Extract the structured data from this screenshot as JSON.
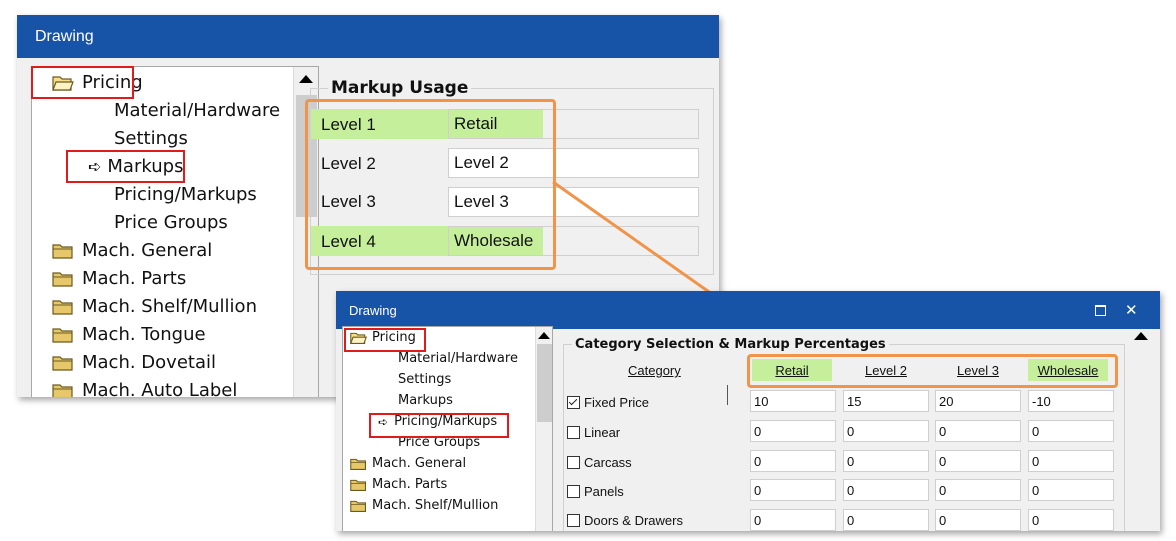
{
  "colors": {
    "titlebar": "#1754a7",
    "highlight": "#c6ef9c",
    "red_outline": "#e01b1b",
    "orange_outline": "#f0944a",
    "folder": "#e6c86a"
  },
  "window1": {
    "title": "Drawing",
    "tree": [
      {
        "label": "Pricing",
        "icon": "folder-open-icon"
      },
      {
        "label": "Material/Hardware"
      },
      {
        "label": "Settings"
      },
      {
        "label": "Markups",
        "icon": "arrow-right-icon"
      },
      {
        "label": "Pricing/Markups"
      },
      {
        "label": "Price Groups"
      },
      {
        "label": "Mach. General",
        "icon": "folder-icon"
      },
      {
        "label": "Mach. Parts",
        "icon": "folder-icon"
      },
      {
        "label": "Mach. Shelf/Mullion",
        "icon": "folder-icon"
      },
      {
        "label": "Mach. Tongue",
        "icon": "folder-icon"
      },
      {
        "label": "Mach. Dovetail",
        "icon": "folder-icon"
      },
      {
        "label": "Mach. Auto Label",
        "icon": "folder-icon"
      }
    ],
    "group_title": "Markup Usage",
    "levels": [
      {
        "label": "Level 1",
        "value": "Retail",
        "highlight": true
      },
      {
        "label": "Level 2",
        "value": "Level 2",
        "highlight": false
      },
      {
        "label": "Level 3",
        "value": "Level 3",
        "highlight": false
      },
      {
        "label": "Level 4",
        "value": "Wholesale",
        "highlight": true
      }
    ]
  },
  "window2": {
    "title": "Drawing",
    "maximize_icon": "maximize-icon",
    "close_label": "✕",
    "tree": [
      {
        "label": "Pricing",
        "icon": "folder-open-icon"
      },
      {
        "label": "Material/Hardware"
      },
      {
        "label": "Settings"
      },
      {
        "label": "Markups"
      },
      {
        "label": "Pricing/Markups",
        "icon": "arrow-right-icon"
      },
      {
        "label": "Price Groups"
      },
      {
        "label": "Mach. General",
        "icon": "folder-icon"
      },
      {
        "label": "Mach. Parts",
        "icon": "folder-icon"
      },
      {
        "label": "Mach. Shelf/Mullion",
        "icon": "folder-icon"
      }
    ],
    "group_title": "Category Selection & Markup Percentages",
    "category_header": "Category",
    "columns": [
      "Retail",
      "Level 2",
      "Level 3",
      "Wholesale"
    ],
    "rows": [
      {
        "label": "Fixed Price",
        "checked": true,
        "values": [
          "10",
          "15",
          "20",
          "-10"
        ]
      },
      {
        "label": "Linear",
        "checked": false,
        "values": [
          "0",
          "0",
          "0",
          "0"
        ]
      },
      {
        "label": "Carcass",
        "checked": false,
        "values": [
          "0",
          "0",
          "0",
          "0"
        ]
      },
      {
        "label": "Panels",
        "checked": false,
        "values": [
          "0",
          "0",
          "0",
          "0"
        ]
      },
      {
        "label": "Doors & Drawers",
        "checked": false,
        "values": [
          "0",
          "0",
          "0",
          "0"
        ]
      }
    ]
  }
}
